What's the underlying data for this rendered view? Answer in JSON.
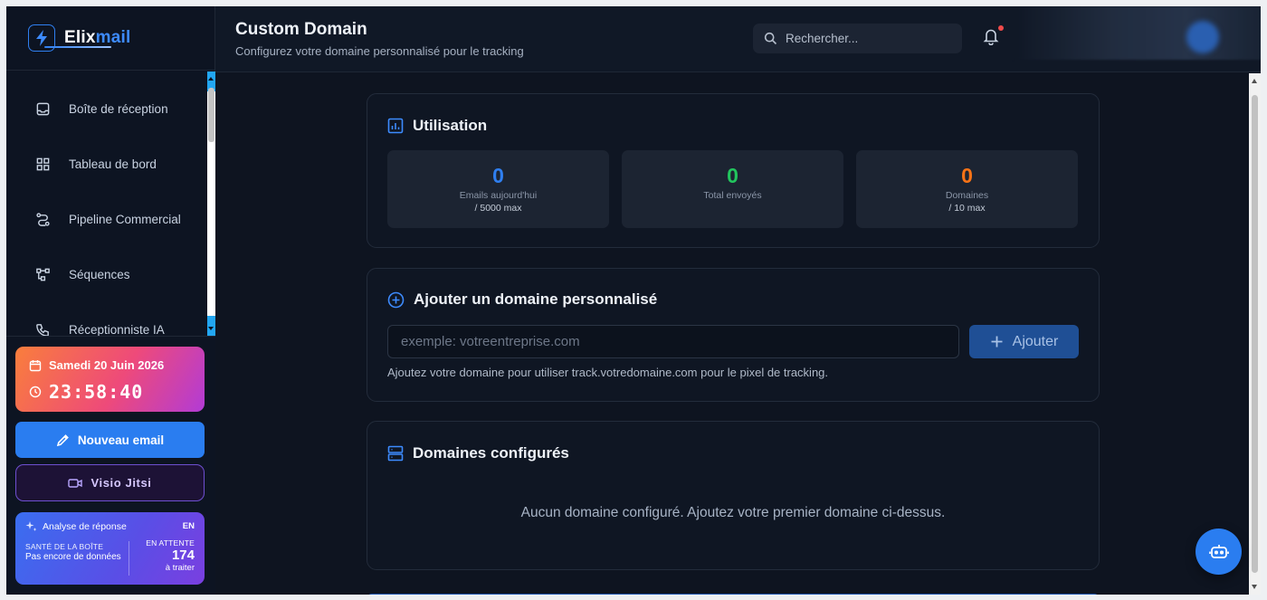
{
  "brand": {
    "name_part1": "Elix",
    "name_part2": "mail"
  },
  "sidebar": {
    "items": [
      {
        "label": "Boîte de réception",
        "icon": "inbox-icon"
      },
      {
        "label": "Tableau de bord",
        "icon": "dashboard-icon"
      },
      {
        "label": "Pipeline Commercial",
        "icon": "pipeline-icon"
      },
      {
        "label": "Séquences",
        "icon": "sequences-icon"
      },
      {
        "label": "Réceptionniste IA",
        "icon": "phone-icon"
      }
    ],
    "date_card": {
      "date": "Samedi 20 Juin 2026",
      "time": "23:58:40"
    },
    "new_email_label": "Nouveau email",
    "jitsi_label": "Visio Jitsi",
    "health": {
      "title": "Analyse de réponse",
      "lang": "EN",
      "left_key": "SANTÉ DE LA BOÎTE",
      "left_value": "Pas encore de données",
      "right_key": "EN ATTENTE",
      "right_number": "174",
      "right_sub": "à traiter"
    }
  },
  "header": {
    "title": "Custom Domain",
    "subtitle": "Configurez votre domaine personnalisé pour le tracking",
    "search_placeholder": "Rechercher..."
  },
  "usage": {
    "title": "Utilisation",
    "stats": [
      {
        "value": "0",
        "label": "Emails aujourd'hui",
        "max": "/ 5000 max",
        "color": "#2f7ff0"
      },
      {
        "value": "0",
        "label": "Total envoyés",
        "max": "",
        "color": "#22c55e"
      },
      {
        "value": "0",
        "label": "Domaines",
        "max": "/ 10 max",
        "color": "#f97316"
      }
    ]
  },
  "add_domain": {
    "title": "Ajouter un domaine personnalisé",
    "input_placeholder": "exemple: votreentreprise.com",
    "button_label": "Ajouter",
    "hint": "Ajoutez votre domaine pour utiliser track.votredomaine.com pour le pixel de tracking."
  },
  "configured": {
    "title": "Domaines configurés",
    "empty_text": "Aucun domaine configuré. Ajoutez votre premier domaine ci-dessus."
  },
  "colors": {
    "accent": "#2a7df0",
    "background": "#0e1420",
    "card": "#0f1623"
  }
}
